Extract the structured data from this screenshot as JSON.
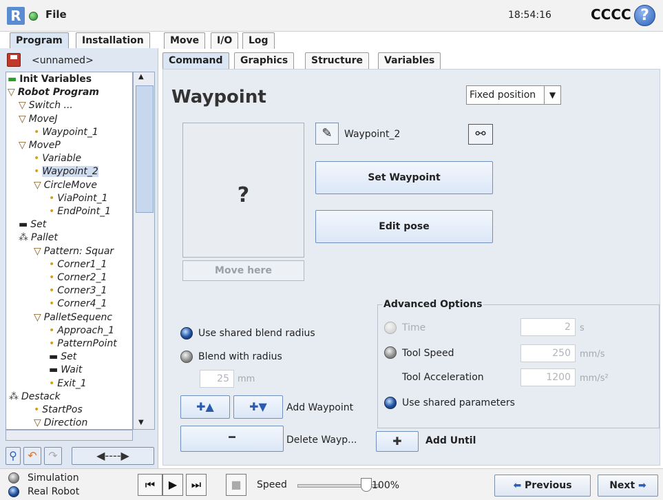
{
  "titlebar": {
    "file_label": "File",
    "time": "18:54:16",
    "robot_name": "CCCC",
    "help_glyph": "?",
    "logo_glyph": "R"
  },
  "main_tabs": [
    "Program",
    "Installation",
    "Move",
    "I/O",
    "Log"
  ],
  "left": {
    "program_name": "<unnamed>",
    "tree": [
      {
        "label": "Init Variables",
        "bold": true,
        "italic": false,
        "selected": false
      },
      {
        "label": "Robot Program",
        "bold": true,
        "italic": true,
        "selected": false
      },
      {
        "label": "Switch ...",
        "bold": false,
        "italic": true,
        "selected": false
      },
      {
        "label": "MoveJ",
        "bold": false,
        "italic": true,
        "selected": false
      },
      {
        "label": "Waypoint_1",
        "bold": false,
        "italic": true,
        "selected": false
      },
      {
        "label": "MoveP",
        "bold": false,
        "italic": true,
        "selected": false
      },
      {
        "label": "Variable",
        "bold": false,
        "italic": true,
        "selected": false
      },
      {
        "label": "Waypoint_2",
        "bold": false,
        "italic": true,
        "selected": true
      },
      {
        "label": "CircleMove",
        "bold": false,
        "italic": true,
        "selected": false
      },
      {
        "label": "ViaPoint_1",
        "bold": false,
        "italic": true,
        "selected": false
      },
      {
        "label": "EndPoint_1",
        "bold": false,
        "italic": true,
        "selected": false
      },
      {
        "label": "Set",
        "bold": false,
        "italic": true,
        "selected": false
      },
      {
        "label": "Pallet",
        "bold": false,
        "italic": true,
        "selected": false
      },
      {
        "label": "Pattern: Squar",
        "bold": false,
        "italic": true,
        "selected": false
      },
      {
        "label": "Corner1_1",
        "bold": false,
        "italic": true,
        "selected": false
      },
      {
        "label": "Corner2_1",
        "bold": false,
        "italic": true,
        "selected": false
      },
      {
        "label": "Corner3_1",
        "bold": false,
        "italic": true,
        "selected": false
      },
      {
        "label": "Corner4_1",
        "bold": false,
        "italic": true,
        "selected": false
      },
      {
        "label": "PalletSequenc",
        "bold": false,
        "italic": true,
        "selected": false
      },
      {
        "label": "Approach_1",
        "bold": false,
        "italic": true,
        "selected": false
      },
      {
        "label": "PatternPoint",
        "bold": false,
        "italic": true,
        "selected": false
      },
      {
        "label": "Set",
        "bold": false,
        "italic": true,
        "selected": false
      },
      {
        "label": "Wait",
        "bold": false,
        "italic": true,
        "selected": false
      },
      {
        "label": "Exit_1",
        "bold": false,
        "italic": true,
        "selected": false
      },
      {
        "label": "Destack",
        "bold": false,
        "italic": true,
        "selected": false
      },
      {
        "label": "StartPos",
        "bold": false,
        "italic": true,
        "selected": false
      },
      {
        "label": "Direction",
        "bold": false,
        "italic": true,
        "selected": false
      }
    ]
  },
  "sub_tabs": [
    "Command",
    "Graphics",
    "Structure",
    "Variables"
  ],
  "command": {
    "title": "Waypoint",
    "position_mode": "Fixed position",
    "preview_glyph": "?",
    "move_here": "Move here",
    "waypoint_name": "Waypoint_2",
    "set_waypoint": "Set Waypoint",
    "edit_pose": "Edit pose",
    "use_shared_blend": "Use shared blend radius",
    "blend_with_radius": "Blend with radius",
    "blend_value": "25",
    "blend_unit": "mm",
    "add_waypoint": "Add Waypoint",
    "delete_waypoint": "Delete Wayp...",
    "advanced": {
      "title": "Advanced Options",
      "time_label": "Time",
      "time_value": "2",
      "time_unit": "s",
      "tool_speed_label": "Tool Speed",
      "tool_speed_value": "250",
      "tool_speed_unit": "mm/s",
      "tool_accel_label": "Tool Acceleration",
      "tool_accel_value": "1200",
      "tool_accel_unit": "mm/s²",
      "shared_params": "Use shared parameters"
    },
    "add_until": "Add Until"
  },
  "bottom": {
    "simulation": "Simulation",
    "real_robot": "Real Robot",
    "speed_label": "Speed",
    "speed_value": "100%",
    "speed_fraction": 1.0,
    "previous": "Previous",
    "next": "Next"
  },
  "colors": {
    "accent": "#2c5fb8",
    "status_ok": "#1f8a1f",
    "selection": "#cfdcf0"
  }
}
